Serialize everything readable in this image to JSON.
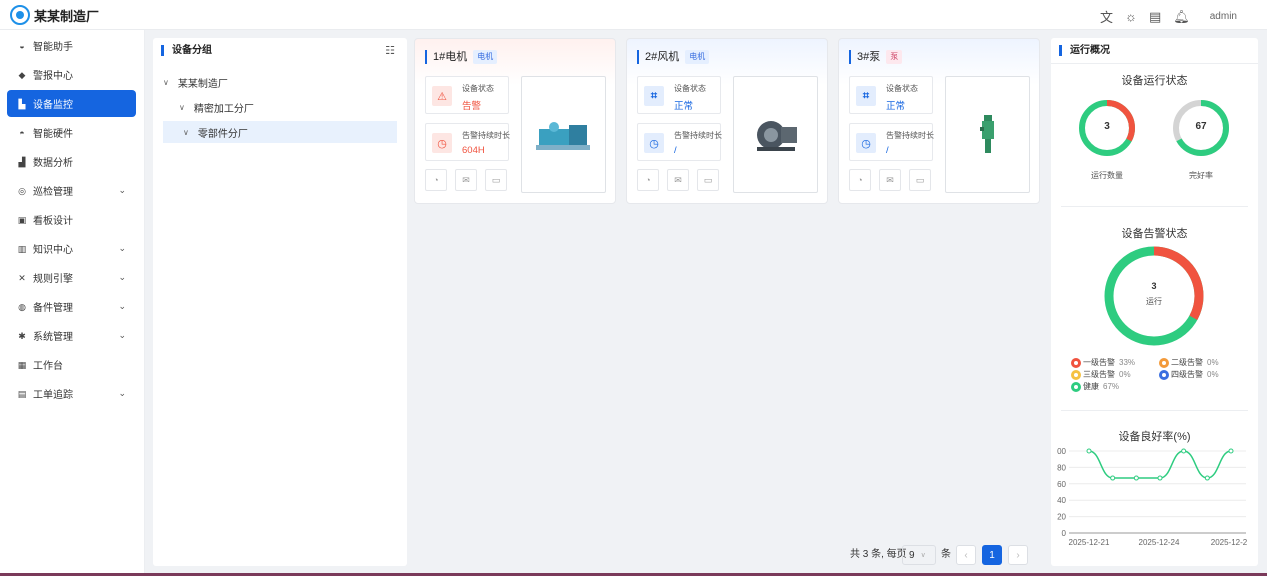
{
  "app": {
    "title": "某某制造厂"
  },
  "header": {
    "user": "admin"
  },
  "sidebar": {
    "items": [
      {
        "label": "智能助手",
        "icon": "robot-icon"
      },
      {
        "label": "警报中心",
        "icon": "alarm-icon"
      },
      {
        "label": "设备监控",
        "icon": "monitor-icon",
        "active": true
      },
      {
        "label": "智能硬件",
        "icon": "hardware-icon"
      },
      {
        "label": "数据分析",
        "icon": "chart-icon"
      },
      {
        "label": "巡检管理",
        "icon": "inspection-icon",
        "expandable": true
      },
      {
        "label": "看板设计",
        "icon": "board-icon"
      },
      {
        "label": "知识中心",
        "icon": "book-icon",
        "expandable": true
      },
      {
        "label": "规则引擎",
        "icon": "rule-icon",
        "expandable": true
      },
      {
        "label": "备件管理",
        "icon": "parts-icon",
        "expandable": true
      },
      {
        "label": "系统管理",
        "icon": "gear-icon",
        "expandable": true
      },
      {
        "label": "工作台",
        "icon": "grid-icon"
      },
      {
        "label": "工单追踪",
        "icon": "clipboard-icon",
        "expandable": true
      }
    ]
  },
  "group_panel": {
    "title": "设备分组",
    "tree": [
      {
        "label": "某某制造厂"
      },
      {
        "label": "精密加工分厂"
      },
      {
        "label": "零部件分厂"
      }
    ]
  },
  "devices": [
    {
      "name": "1#电机",
      "tag": "电机",
      "status_label": "设备状态",
      "status": "告警",
      "duration_label": "告警持续时长",
      "duration": "604H"
    },
    {
      "name": "2#风机",
      "tag": "电机",
      "status_label": "设备状态",
      "status": "正常",
      "duration_label": "告警持续时长",
      "duration": "/"
    },
    {
      "name": "3#泵",
      "tag": "泵",
      "status_label": "设备状态",
      "status": "正常",
      "duration_label": "告警持续时长",
      "duration": "/"
    }
  ],
  "colors": {
    "primary": "#1565e0",
    "alarm": "#f0533f",
    "healthy": "#2ecc80",
    "grey": "#d4d4d4",
    "orange": "#f39a3a",
    "yellow": "#f5c242",
    "blue": "#3a6fe0"
  },
  "pagination": {
    "summary": "共 3 条, 每页",
    "page_size": "9",
    "unit": "条",
    "current": "1"
  },
  "overview": {
    "title": "运行概况",
    "run_status": {
      "title": "设备运行状态",
      "count_value": "3",
      "count_label": "运行数量",
      "rate_value": "67",
      "rate_label": "完好率"
    },
    "alarm_status": {
      "title": "设备告警状态",
      "center_value": "3",
      "center_label": "运行"
    },
    "legend": [
      {
        "label": "一级告警",
        "pct": "33%"
      },
      {
        "label": "二级告警",
        "pct": "0%"
      },
      {
        "label": "三级告警",
        "pct": "0%"
      },
      {
        "label": "四级告警",
        "pct": "0%"
      },
      {
        "label": "健康",
        "pct": "67%"
      }
    ],
    "rate_chart_title": "设备良好率(%)"
  },
  "chart_data": {
    "type": "line",
    "title": "设备良好率(%)",
    "xlabel": "",
    "ylabel": "",
    "ylim": [
      0,
      100
    ],
    "yticks": [
      "0",
      "20",
      "40",
      "60",
      "80",
      "00"
    ],
    "xticks": [
      "2025-12-21",
      "2025-12-24",
      "2025-12-2"
    ],
    "series": [
      {
        "values": [
          100,
          67,
          67,
          67,
          100,
          67,
          100
        ]
      }
    ],
    "grid": true
  }
}
